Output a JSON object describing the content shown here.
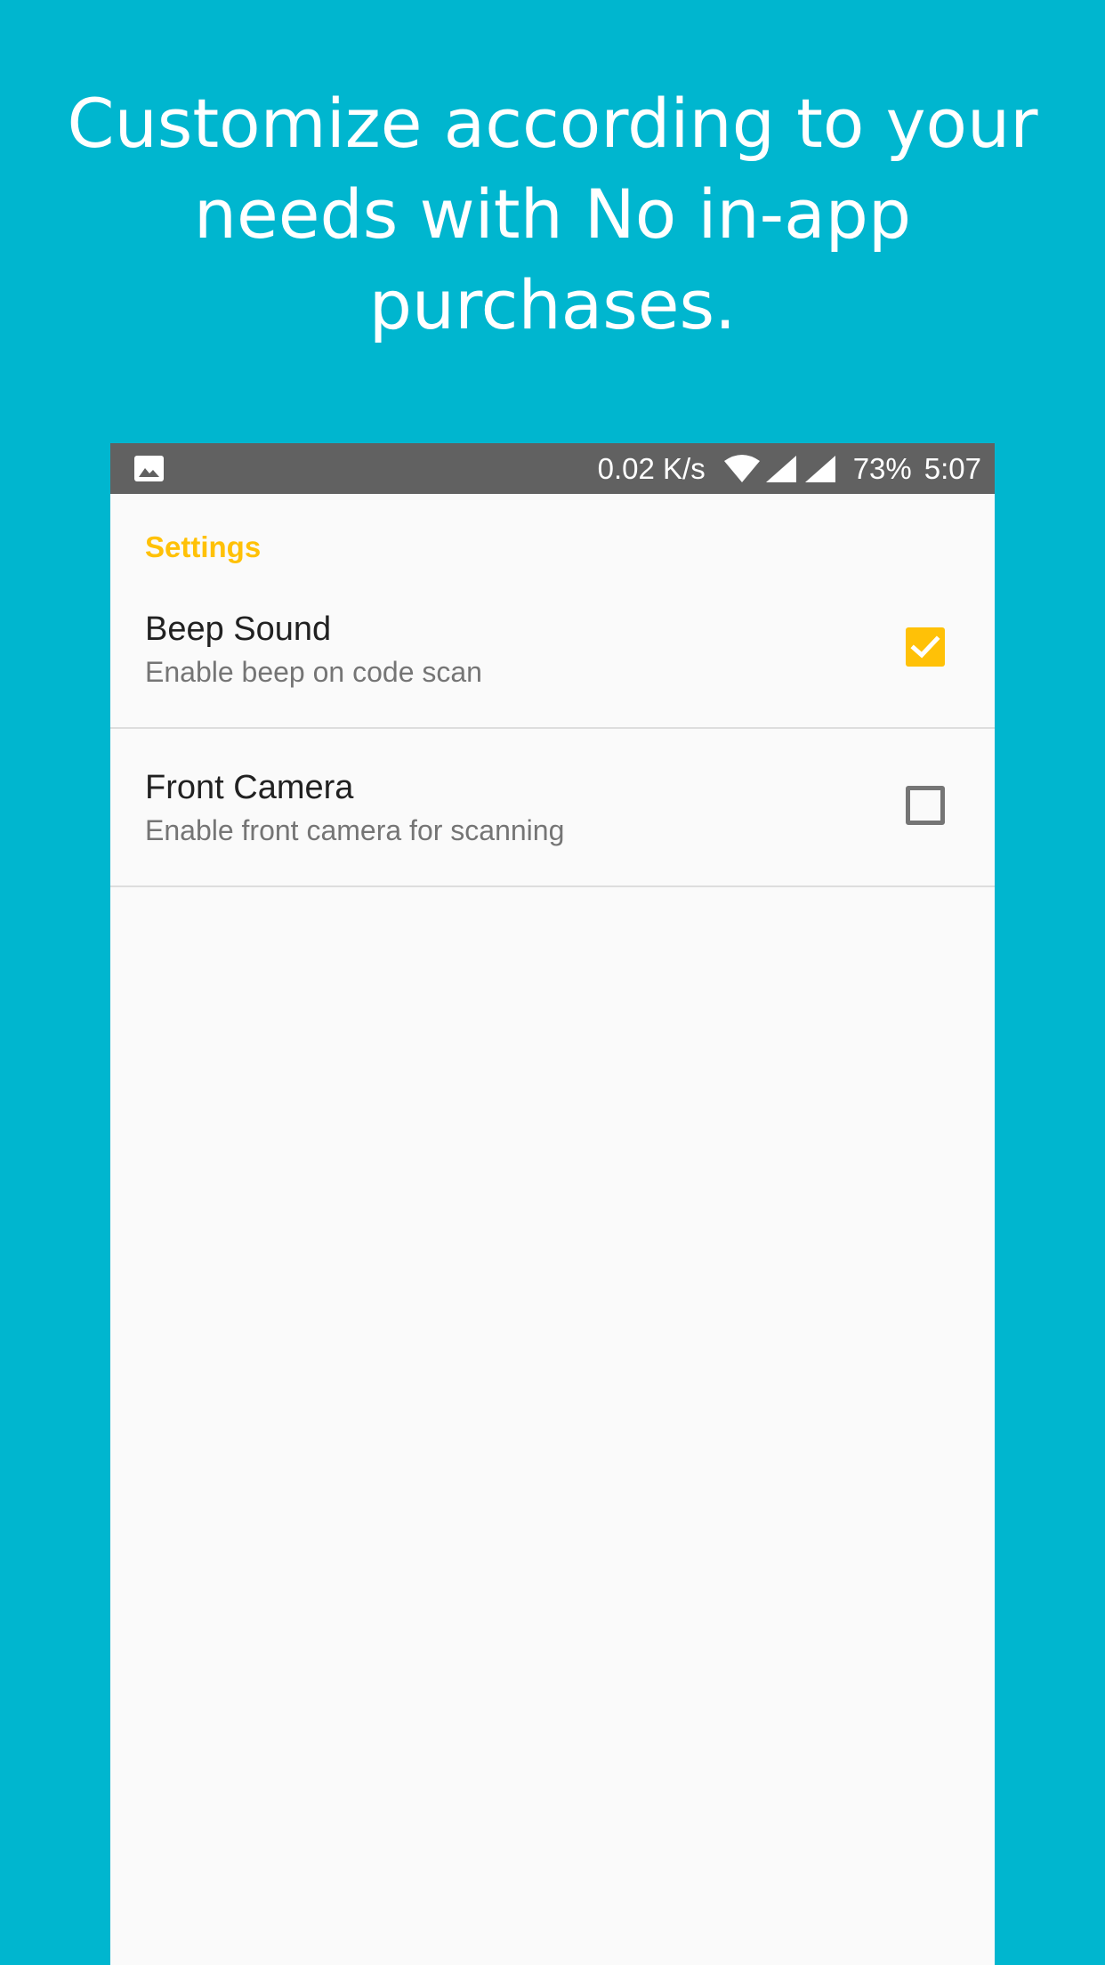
{
  "promo": {
    "line1": "Customize according to your",
    "line2": "needs with No in-app",
    "line3": "purchases."
  },
  "status_bar": {
    "notification_icon": "image-icon",
    "speed": "0.02 K/s",
    "wifi_icon": "wifi-icon",
    "signal_icon": "signal-icon",
    "battery": "73%",
    "time": "5:07"
  },
  "settings": {
    "header": "Settings",
    "items": [
      {
        "title": "Beep Sound",
        "summary": "Enable beep on code scan",
        "checked": true
      },
      {
        "title": "Front Camera",
        "summary": "Enable front camera for scanning",
        "checked": false
      }
    ]
  },
  "colors": {
    "background": "#00B6CF",
    "status_bar": "#616161",
    "accent": "#FFC107",
    "screen": "#FAFAFA"
  }
}
